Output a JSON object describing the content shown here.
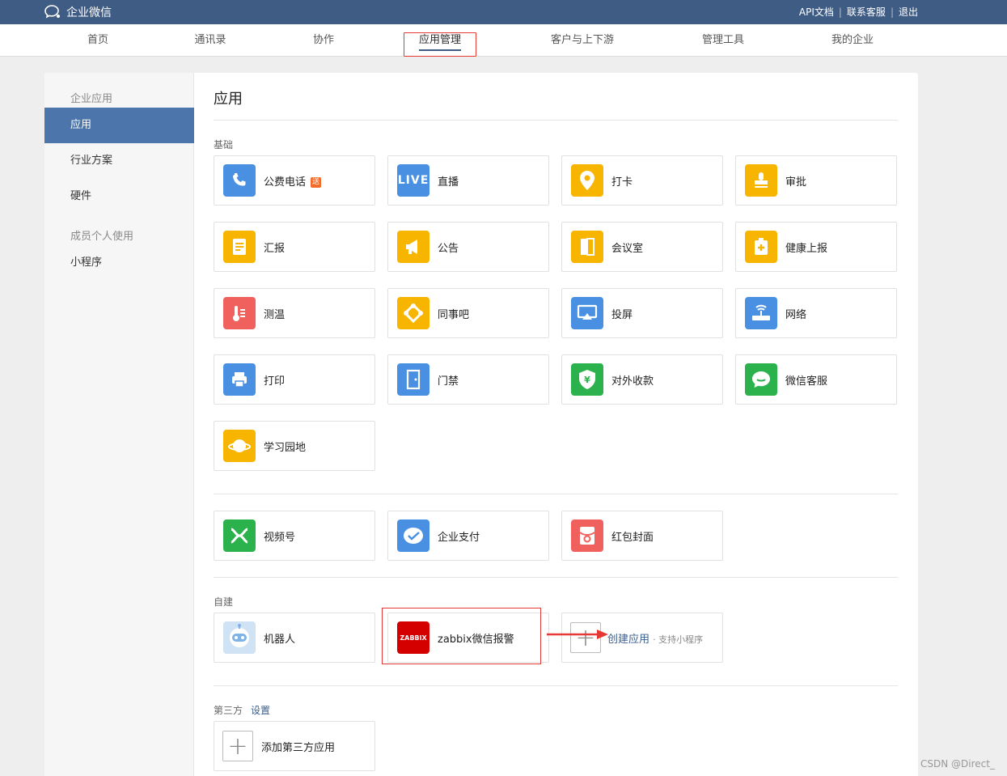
{
  "header": {
    "brand": "企业微信",
    "links": [
      "API文档",
      "联系客服",
      "退出"
    ]
  },
  "nav": {
    "items": [
      "首页",
      "通讯录",
      "协作",
      "应用管理",
      "客户与上下游",
      "管理工具",
      "我的企业"
    ],
    "active": "应用管理"
  },
  "sidebar": {
    "group1": "企业应用",
    "items1": [
      "应用",
      "行业方案",
      "硬件"
    ],
    "group2": "成员个人使用",
    "items2": [
      "小程序"
    ]
  },
  "main": {
    "title": "应用",
    "basic_label": "基础",
    "basic_apps": [
      {
        "label": "公费电话",
        "badge": "送",
        "icon": "phone-icon",
        "color": "#4a90e2"
      },
      {
        "label": "直播",
        "icon": "live-icon",
        "icon_text": "LIVE",
        "color": "#4a90e2"
      },
      {
        "label": "打卡",
        "icon": "location-pin-icon",
        "color": "#f7b500"
      },
      {
        "label": "审批",
        "icon": "stamp-icon",
        "color": "#f7b500"
      },
      {
        "label": "汇报",
        "icon": "report-icon",
        "color": "#f7b500"
      },
      {
        "label": "公告",
        "icon": "megaphone-icon",
        "color": "#f7b500"
      },
      {
        "label": "会议室",
        "icon": "door-icon",
        "color": "#f7b500"
      },
      {
        "label": "健康上报",
        "icon": "health-icon",
        "color": "#f7b500"
      },
      {
        "label": "测温",
        "icon": "thermometer-icon",
        "color": "#f0605d"
      },
      {
        "label": "同事吧",
        "icon": "colleague-icon",
        "color": "#f7b500"
      },
      {
        "label": "投屏",
        "icon": "screencast-icon",
        "color": "#4a90e2"
      },
      {
        "label": "网络",
        "icon": "wifi-router-icon",
        "color": "#4a90e2"
      },
      {
        "label": "打印",
        "icon": "printer-icon",
        "color": "#4a90e2"
      },
      {
        "label": "门禁",
        "icon": "door-access-icon",
        "color": "#4a90e2"
      },
      {
        "label": "对外收款",
        "icon": "yuan-shield-icon",
        "color": "#2bb24c"
      },
      {
        "label": "微信客服",
        "icon": "chat-bubble-icon",
        "color": "#2bb24c"
      },
      {
        "label": "学习园地",
        "icon": "planet-icon",
        "color": "#f7b500"
      }
    ],
    "wechat_apps": [
      {
        "label": "视频号",
        "icon": "channels-icon",
        "color": "#2bb24c"
      },
      {
        "label": "企业支付",
        "icon": "pay-icon",
        "color": "#4a90e2"
      },
      {
        "label": "红包封面",
        "icon": "red-packet-icon",
        "color": "#f0605d"
      }
    ],
    "custom_label": "自建",
    "custom_apps": [
      {
        "label": "机器人",
        "icon": "robot-icon",
        "color": "#cfe3f5"
      },
      {
        "label": "zabbix微信报警",
        "icon": "zabbix-icon",
        "icon_text": "ZABBIX",
        "color": "#d40000"
      }
    ],
    "create": {
      "label": "创建应用",
      "sub": "· 支持小程序"
    },
    "third_label": "第三方",
    "third_link": "设置",
    "add_third": "添加第三方应用"
  },
  "watermark": "CSDN @Direct_"
}
